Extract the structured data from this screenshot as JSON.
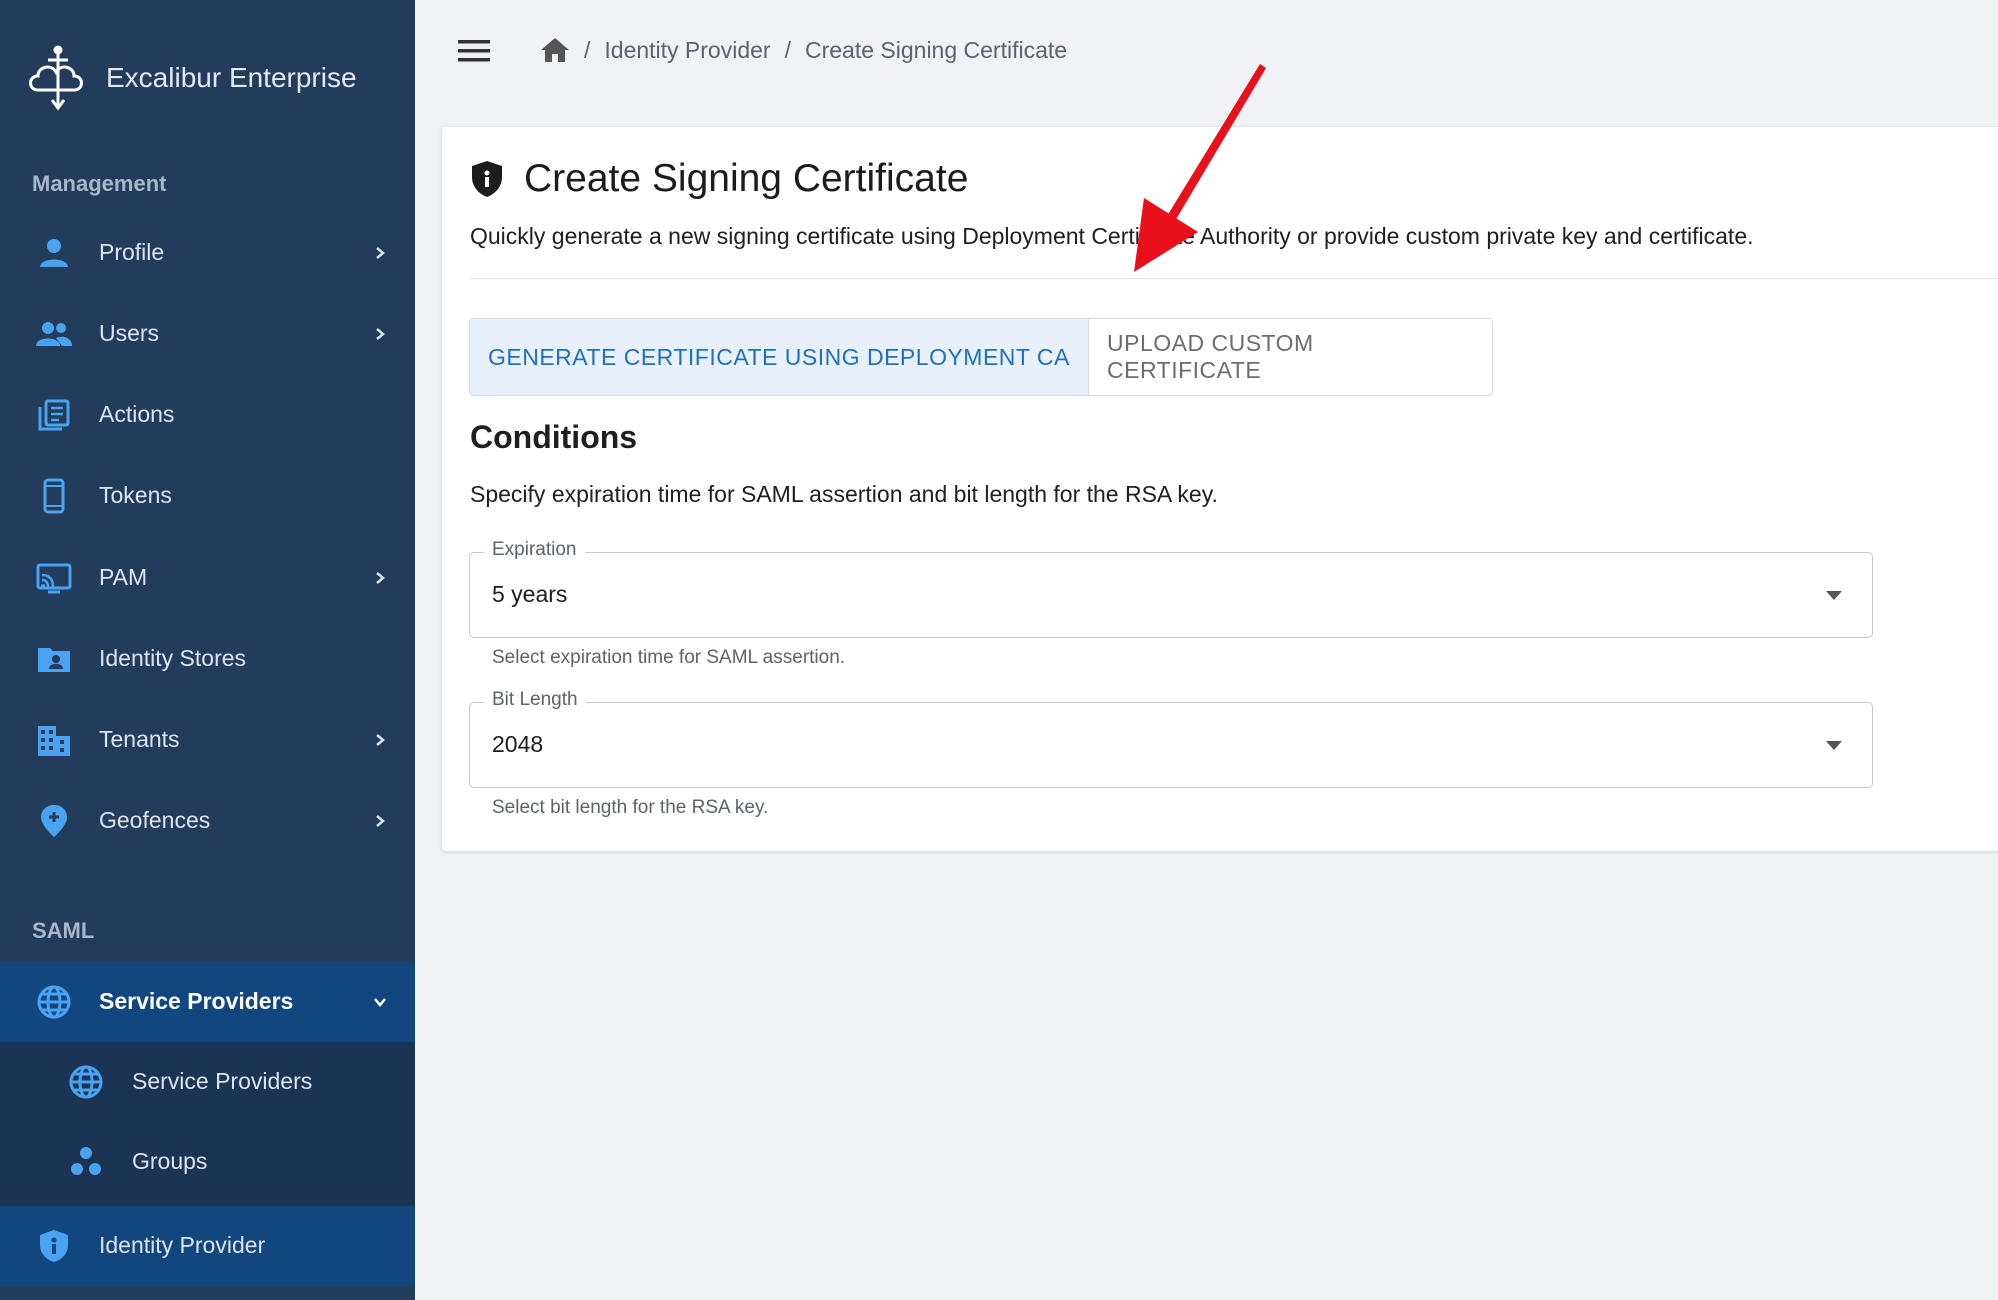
{
  "brand": {
    "name": "Excalibur Enterprise"
  },
  "sidebar": {
    "sections": [
      {
        "label": "Management"
      },
      {
        "label": "SAML"
      }
    ],
    "management_items": [
      {
        "label": "Profile",
        "icon": "person-icon",
        "has_children": true
      },
      {
        "label": "Users",
        "icon": "users-icon",
        "has_children": true
      },
      {
        "label": "Actions",
        "icon": "actions-list-icon",
        "has_children": false
      },
      {
        "label": "Tokens",
        "icon": "phone-icon",
        "has_children": false
      },
      {
        "label": "PAM",
        "icon": "cast-screen-icon",
        "has_children": true
      },
      {
        "label": "Identity Stores",
        "icon": "folder-user-icon",
        "has_children": false
      },
      {
        "label": "Tenants",
        "icon": "building-icon",
        "has_children": true
      },
      {
        "label": "Geofences",
        "icon": "location-pin-icon",
        "has_children": true
      }
    ],
    "saml_items": [
      {
        "label": "Service Providers",
        "icon": "globe-icon",
        "expanded": true
      },
      {
        "label": "Service Providers",
        "icon": "globe-icon"
      },
      {
        "label": "Groups",
        "icon": "groups-icon"
      },
      {
        "label": "Identity Provider",
        "icon": "shield-icon"
      }
    ]
  },
  "breadcrumb": {
    "items": [
      "Identity Provider",
      "Create Signing Certificate"
    ],
    "separator": "/"
  },
  "card": {
    "title": "Create Signing Certificate",
    "description": "Quickly generate a new signing certificate using Deployment Certificate Authority or provide custom private key and certificate.",
    "toggle": {
      "options": [
        "GENERATE CERTIFICATE USING DEPLOYMENT CA",
        "UPLOAD CUSTOM CERTIFICATE"
      ],
      "selected": "GENERATE CERTIFICATE USING DEPLOYMENT CA"
    },
    "conditions": {
      "title": "Conditions",
      "description": "Specify expiration time for SAML assertion and bit length for the RSA key.",
      "expiration": {
        "label": "Expiration",
        "value": "5 years",
        "helper": "Select expiration time for SAML assertion."
      },
      "bit_length": {
        "label": "Bit Length",
        "value": "2048",
        "helper": "Select bit length for the RSA key."
      }
    }
  },
  "colors": {
    "sidebar_bg": "#233c5b",
    "sidebar_active": "#12467e",
    "accent": "#1f6fc2",
    "annotation_arrow": "#e8101a"
  }
}
